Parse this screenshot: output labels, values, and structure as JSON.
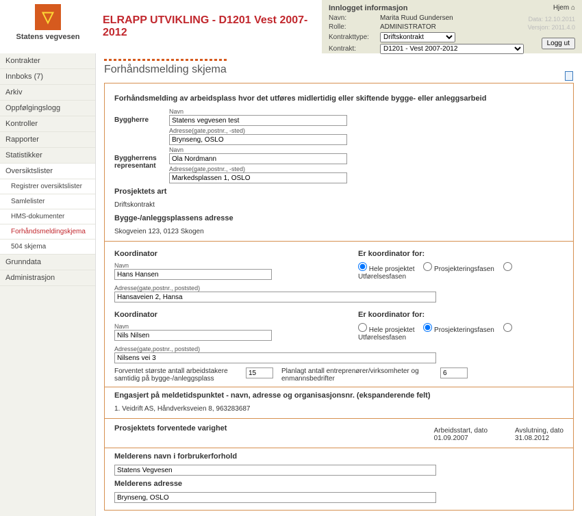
{
  "header": {
    "app_title": "ELRAPP UTVIKLING - D1201 Vest 2007-2012",
    "org_name": "Statens vegvesen"
  },
  "session": {
    "title": "Innlogget informasjon",
    "name_label": "Navn:",
    "name": "Marita Ruud Gundersen",
    "role_label": "Rolle:",
    "role": "ADMINISTRATOR",
    "ktype_label": "Kontrakttype:",
    "ktype": "Driftskontrakt",
    "kontrakt_label": "Kontrakt:",
    "kontrakt": "D1201 - Vest 2007-2012",
    "home": "Hjem",
    "date": "Data: 12.10.2011",
    "version": "Versjon: 2011.4.0",
    "logout": "Logg ut"
  },
  "nav": {
    "kontrakter": "Kontrakter",
    "innboks": "Innboks (7)",
    "arkiv": "Arkiv",
    "oppf": "Oppfølgingslogg",
    "kontroller": "Kontroller",
    "rapporter": "Rapporter",
    "statistikker": "Statistikker",
    "oversiktslister": "Oversiktslister",
    "sub_reg": "Registrer oversiktslister",
    "sub_saml": "Samlelister",
    "sub_hms": "HMS-dokumenter",
    "sub_forh": "Forhåndsmeldingskjema",
    "sub_504": "504 skjema",
    "grunndata": "Grunndata",
    "admin": "Administrasjon"
  },
  "page": {
    "title": "Forhåndsmelding skjema",
    "intro": "Forhåndsmelding av arbeidsplass hvor det utføres midlertidig eller skiftende bygge- eller anleggsarbeid"
  },
  "labels": {
    "byggherre": "Byggherre",
    "navn": "Navn",
    "adresse": "Adresse(gate,postnr., -sted)",
    "adresse2": "Adresse(gate,postnr., poststed)",
    "byggherrens_rep": "Byggherrens representant",
    "prosj_art": "Prosjektets art",
    "bygge_adr": "Bygge-/anleggsplassens adresse",
    "koordinator": "Koordinator",
    "er_koord": "Er koordinator for:",
    "r_hele": "Hele prosjektet",
    "r_prosj": "Prosjekteringsfasen",
    "r_utf": "Utførelsesfasen",
    "forventet_antall": "Forventet største antall arbeidstakere samtidig på bygge-/anleggsplass",
    "planlagt_antall": "Planlagt antall entreprenører/virksomheter og enmannsbedrifter",
    "engasjert": "Engasjert på meldetidspunktet - navn, adresse og organisasjonsnr. (ekspanderende felt)",
    "engasjert_1": "1. Veidrift AS, Håndverksveien 8, 963283687",
    "varighet": "Prosjektets forventede varighet",
    "arb_start": "Arbeidsstart, dato",
    "avslutning": "Avslutning, dato",
    "melder_navn": "Melderens navn i forbrukerforhold",
    "melder_adr": "Melderens adresse"
  },
  "form": {
    "byggherre_navn": "Statens vegvesen test",
    "byggherre_adr": "Brynseng, OSLO",
    "rep_navn": "Ola Nordmann",
    "rep_adr": "Markedsplassen 1, OSLO",
    "prosj_art": "Driftskontrakt",
    "bygge_adr": "Skogveien 123, 0123 Skogen",
    "k1_navn": "Hans Hansen",
    "k1_adr": "Hansaveien 2, Hansa",
    "k2_navn": "Nils Nilsen",
    "k2_adr": "Nilsens vei 3",
    "antall1": "15",
    "antall2": "6",
    "start_dato": "01.09.2007",
    "slutt_dato": "31.08.2012",
    "melder_navn": "Statens Vegvesen",
    "melder_adr": "Brynseng, OSLO"
  }
}
